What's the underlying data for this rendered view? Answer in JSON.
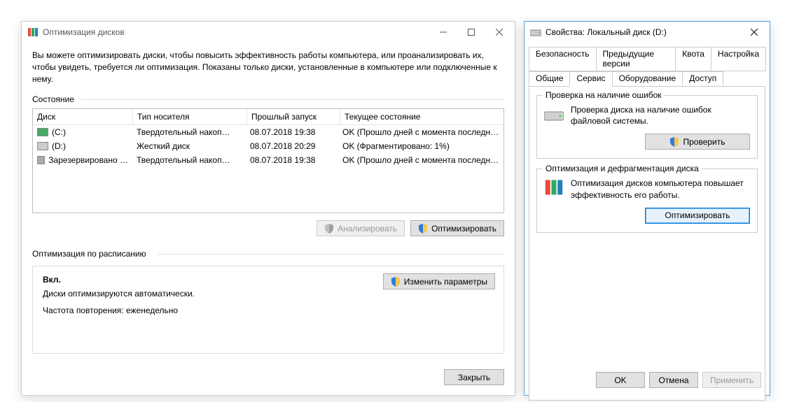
{
  "optim": {
    "title": "Оптимизация дисков",
    "description": "Вы можете оптимизировать диски, чтобы повысить эффективность работы  компьютера, или проанализировать их, чтобы увидеть, требуется ли оптимизация. Показаны только диски, установленные в компьютере или подключенные к нему.",
    "state_label": "Состояние",
    "columns": {
      "disk": "Диск",
      "media": "Тип носителя",
      "last": "Прошлый запуск",
      "state": "Текущее состояние"
    },
    "rows": [
      {
        "name": "(C:)",
        "media": "Твердотельный накоп…",
        "last": "08.07.2018 19:38",
        "state": "OK (Прошло дней с момента последне…",
        "icon": "ssd"
      },
      {
        "name": "(D:)",
        "media": "Жесткий диск",
        "last": "08.07.2018 20:29",
        "state": "OK (Фрагментировано: 1%)",
        "icon": "hdd"
      },
      {
        "name": "Зарезервировано …",
        "media": "Твердотельный накоп…",
        "last": "08.07.2018 19:38",
        "state": "OK (Прошло дней с момента последне…",
        "icon": "res"
      }
    ],
    "analyze_btn": "Анализировать",
    "optimize_btn": "Оптимизировать",
    "schedule_label": "Оптимизация по расписанию",
    "schedule_on": "Вкл.",
    "schedule_auto": "Диски оптимизируются автоматически.",
    "schedule_freq": "Частота повторения: еженедельно",
    "change_settings_btn": "Изменить параметры",
    "close_btn": "Закрыть"
  },
  "props": {
    "title": "Свойства: Локальный диск (D:)",
    "tabs_top": [
      "Безопасность",
      "Предыдущие версии",
      "Квота",
      "Настройка"
    ],
    "tabs_bottom": [
      "Общие",
      "Сервис",
      "Оборудование",
      "Доступ"
    ],
    "active_tab": "Сервис",
    "check_group": {
      "legend": "Проверка на наличие ошибок",
      "text": "Проверка диска на наличие ошибок файловой системы.",
      "btn": "Проверить"
    },
    "defrag_group": {
      "legend": "Оптимизация и дефрагментация диска",
      "text": "Оптимизация дисков компьютера повышает эффективность его работы.",
      "btn": "Оптимизировать"
    },
    "ok_btn": "OK",
    "cancel_btn": "Отмена",
    "apply_btn": "Применить"
  }
}
